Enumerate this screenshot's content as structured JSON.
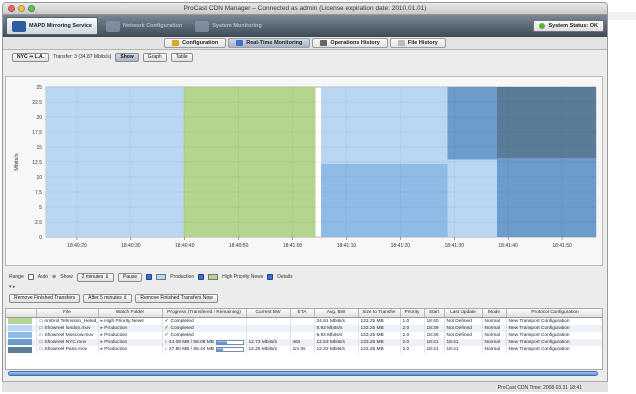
{
  "window": {
    "title": "ProCast CDN Manager – Connected as admin (License expiration date: 2010.01.01)"
  },
  "appbar": {
    "tabs": [
      {
        "label": "MAPD Mirroring Service",
        "icon": "mirroring-icon",
        "active": true
      },
      {
        "label": "Network Configuration",
        "icon": "network-icon",
        "active": false
      },
      {
        "label": "System Monitoring",
        "icon": "monitor-icon",
        "active": false
      }
    ],
    "system_status": "System Status: OK"
  },
  "subtabs": [
    {
      "label": "Configuration",
      "icon": "configuration-icon",
      "active": false
    },
    {
      "label": "Real-Time Monitoring",
      "icon": "realtime-icon",
      "active": true
    },
    {
      "label": "Operations History",
      "icon": "history-icon",
      "active": false
    },
    {
      "label": "File History",
      "icon": "file-history-icon",
      "active": false
    }
  ],
  "toolbar": {
    "route": "NYC ⇒ L.A.",
    "transfer_label": "Transfer: 3 (34.87 Mbits/s)",
    "show_label": "Show",
    "graph_label": "Graph",
    "table_label": "Table"
  },
  "chart_data": {
    "type": "area",
    "ylabel": "Mbits/s",
    "ylim": [
      0,
      25
    ],
    "yticks": [
      "0",
      "2.5",
      "5",
      "7.5",
      "10",
      "12.5",
      "15",
      "17.5",
      "20",
      "22.5",
      "25"
    ],
    "xticks": [
      "18:40:20",
      "18:40:30",
      "18:40:40",
      "18:40:50",
      "18:41:00",
      "18:41:10",
      "18:41:20",
      "18:41:30",
      "18:41:40",
      "18:41:50"
    ],
    "grid": true,
    "legend": [
      "Production",
      "High Priority News"
    ],
    "colors": {
      "production_light": "#b9d7f2",
      "production_mid": "#8fbbe6",
      "production_dark": "#6c9ccc",
      "high_priority": "#b5d48f",
      "dark_band": "#5b7c98"
    },
    "bands": [
      {
        "from": 0,
        "to": 0.1,
        "layers": [
          {
            "series": "production_light",
            "upper": 25,
            "lower": 0
          }
        ]
      },
      {
        "from": 0.1,
        "to": 0.25,
        "layers": [
          {
            "series": "production_light",
            "upper": 25,
            "lower": 0
          }
        ]
      },
      {
        "from": 0.25,
        "to": 0.49,
        "layers": [
          {
            "series": "high_priority",
            "upper": 25,
            "lower": 0
          }
        ]
      },
      {
        "from": 0.5,
        "to": 0.73,
        "layers": [
          {
            "series": "production_light",
            "upper": 25,
            "lower": 12.2
          },
          {
            "series": "production_mid",
            "upper": 12.2,
            "lower": 0
          }
        ]
      },
      {
        "from": 0.73,
        "to": 0.82,
        "layers": [
          {
            "series": "production_dark",
            "upper": 25,
            "lower": 12.9
          },
          {
            "series": "production_light",
            "upper": 12.9,
            "lower": 0
          }
        ]
      },
      {
        "from": 0.82,
        "to": 1.0,
        "layers": [
          {
            "series": "dark_band",
            "upper": 25,
            "lower": 13.1
          },
          {
            "series": "production_dark",
            "upper": 13.1,
            "lower": 0
          }
        ]
      }
    ]
  },
  "rangebar": {
    "range_label": "Range",
    "auto_label": "Auto",
    "show_label": "Show",
    "show_value": "2 minutes",
    "pause_label": "Pause",
    "legend_production": "Production",
    "legend_high_priority": "High Priority News",
    "details_label": "Details"
  },
  "remove": {
    "remove_finished_label": "Remove Finished Transfers",
    "after_value": "After 5 minutes",
    "remove_now_label": "Remove Finished Transfers Now"
  },
  "table": {
    "columns": [
      "",
      "File",
      "Watch Folder",
      "Progress (Transfered / Remaining)",
      "Current BW",
      "ETA",
      "Avg. BW",
      "Size to Transfer",
      "Priority",
      "Start",
      "Last Update",
      "Mode",
      "Protocol Configuration"
    ],
    "rows": [
      {
        "swatch": "#b5d48f",
        "file": "Ambrol Tehnsson_Heled_84...",
        "folder": "High Priority News",
        "progress": "Completed",
        "done": true,
        "fraction": 1,
        "current_bw": "",
        "eta": "",
        "avg_bw": "24.91 Mbits/s",
        "size": "133.25 MB",
        "priority": "1.0",
        "start": "18:40",
        "last_update": "Not Defined",
        "mode": "Normal",
        "protocol": "New Transport Configuration"
      },
      {
        "swatch": "#b9d7f2",
        "file": "Showreel london.mov",
        "folder": "Production",
        "progress": "Completed",
        "done": true,
        "fraction": 1,
        "current_bw": "",
        "eta": "",
        "avg_bw": "8.93 Mbits/s",
        "size": "133.25 MB",
        "priority": "2.0",
        "start": "18:39",
        "last_update": "Not Defined",
        "mode": "Normal",
        "protocol": "New Transport Configuration"
      },
      {
        "swatch": "#8fbbe6",
        "file": "Showreel Moscow.mov",
        "folder": "Production",
        "progress": "Completed",
        "done": true,
        "fraction": 1,
        "current_bw": "",
        "eta": "",
        "avg_bw": "8.93 Mbits/s",
        "size": "133.25 MB",
        "priority": "2.0",
        "start": "18:39",
        "last_update": "Not Defined",
        "mode": "Normal",
        "protocol": "New Transport Configuration"
      },
      {
        "swatch": "#6c9ccc",
        "file": "Showreel NYC.mov",
        "folder": "Production",
        "progress": "44.08 MB / 68.08 MB",
        "done": false,
        "fraction": 0.39,
        "current_bw": "12.73 Mbits/s",
        "eta": "46s",
        "avg_bw": "12.53 Mbits/s",
        "size": "133.25 MB",
        "priority": "2.0",
        "start": "18:41",
        "last_update": "18:41",
        "mode": "Normal",
        "protocol": "New Transport Configuration"
      },
      {
        "swatch": "#5b7c98",
        "file": "Showreel Paris.mov",
        "folder": "Production",
        "progress": "27.80 MB / 85.44 MB",
        "done": false,
        "fraction": 0.25,
        "current_bw": "12.25 Mbits/s",
        "eta": "1m 0s",
        "avg_bw": "12.32 Mbits/s",
        "size": "133.25 MB",
        "priority": "2.0",
        "start": "18:41",
        "last_update": "18:41",
        "mode": "Normal",
        "protocol": "New Transport Configuration"
      }
    ]
  },
  "statusbar": {
    "text": "ProCast CDN Time: 2008.03.31 18:41"
  }
}
